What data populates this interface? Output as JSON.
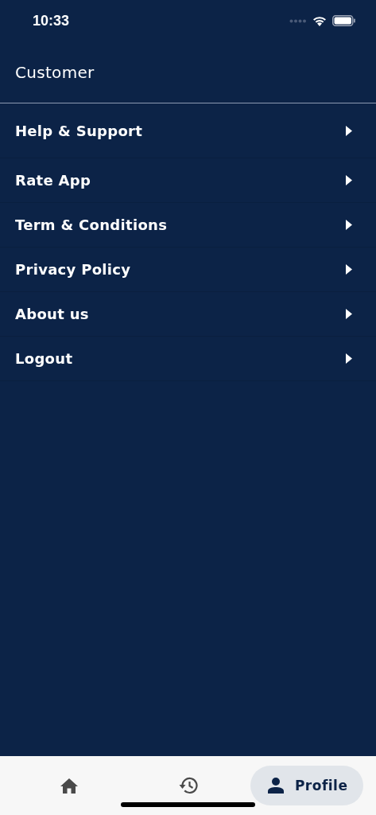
{
  "status_bar": {
    "time": "10:33"
  },
  "header": {
    "title": "Customer"
  },
  "menu": [
    {
      "label": "Help & Support"
    },
    {
      "label": "Rate App"
    },
    {
      "label": "Term & Conditions"
    },
    {
      "label": "Privacy Policy"
    },
    {
      "label": "About us"
    },
    {
      "label": "Logout"
    }
  ],
  "bottom_nav": [
    {
      "kind": "home",
      "selected": false
    },
    {
      "kind": "history",
      "selected": false
    },
    {
      "kind": "profile",
      "label": "Profile",
      "selected": true
    }
  ]
}
